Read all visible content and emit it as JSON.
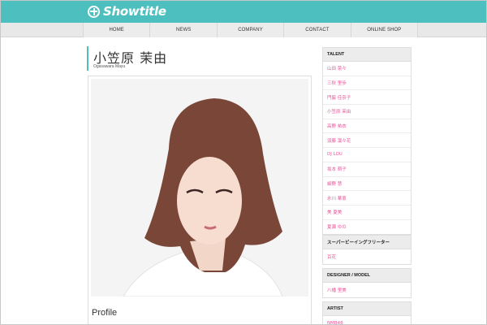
{
  "brand": {
    "name": "Showtitle",
    "accent": "#4dbfbf",
    "link_color": "#e8559a"
  },
  "nav": [
    "HOME",
    "NEWS",
    "COMPANY",
    "CONTACT",
    "ONLINE SHOP"
  ],
  "page": {
    "title_jp": "小笠原 茉由",
    "title_en": "Ogasawara Mayu",
    "profile_heading": "Profile"
  },
  "sidebar": {
    "talent": {
      "heading": "TALENT",
      "items": [
        "山田 菜々",
        "三秋 里歩",
        "門脇 佳奈子",
        "小笠原 茉由",
        "高野 祐衣",
        "須藤 凜々花",
        "DJ LOU",
        "坂本 萌子",
        "細野 慧",
        "氷川 華恵",
        "美 夏美",
        "夏瀬 ゆの"
      ]
    },
    "super": {
      "heading": "スーパービーイングフリーター",
      "items": [
        "百花"
      ]
    },
    "designer": {
      "heading": "DESIGNER / MODEL",
      "items": [
        "八幡 里美"
      ]
    },
    "artist": {
      "heading": "ARTIST",
      "items": [
        "NMB48"
      ]
    }
  }
}
